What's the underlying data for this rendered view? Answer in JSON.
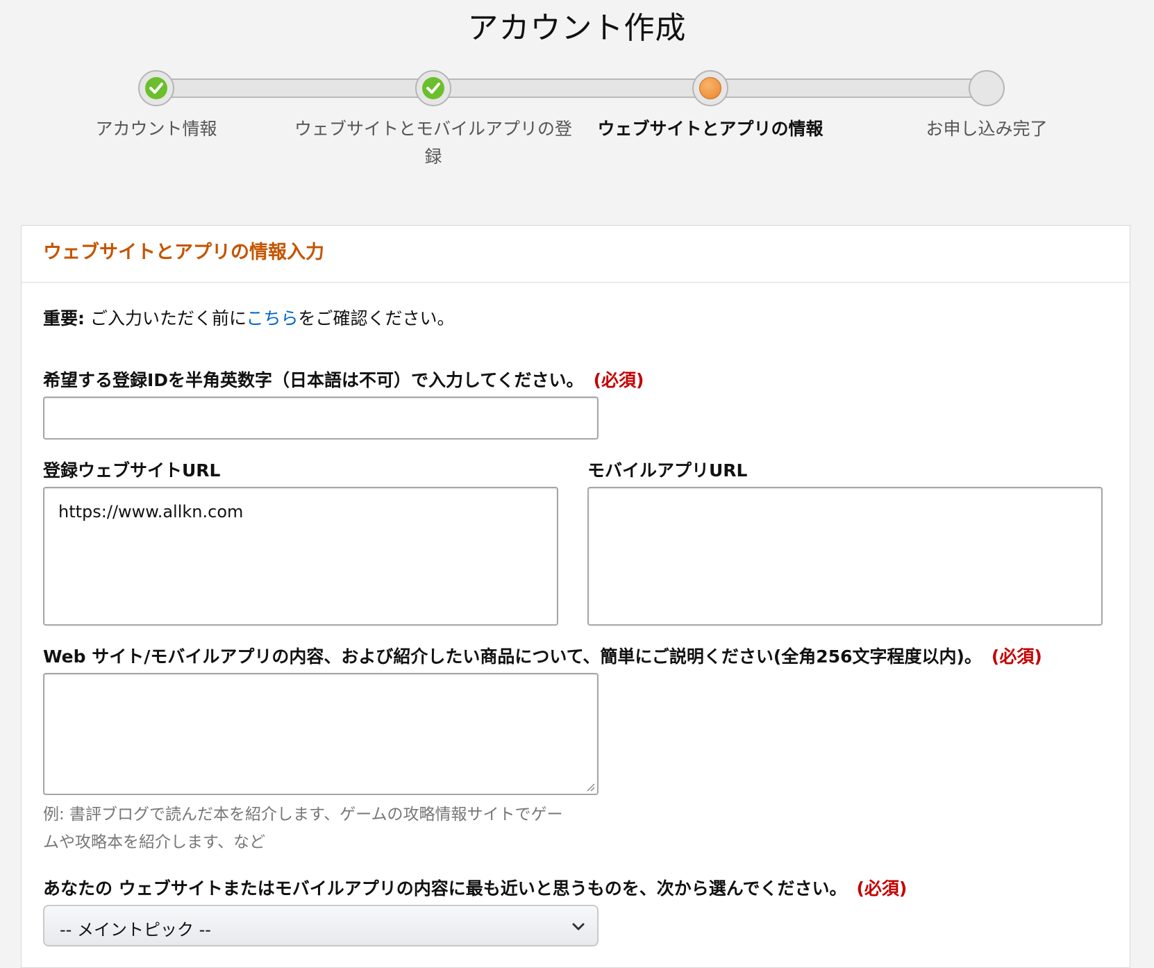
{
  "page": {
    "title": "アカウント作成"
  },
  "progress": {
    "steps": [
      {
        "label": "アカウント情報",
        "status": "done"
      },
      {
        "label": "ウェブサイトとモバイルアプリの登録",
        "status": "done"
      },
      {
        "label": "ウェブサイトとアプリの情報",
        "status": "current"
      },
      {
        "label": "お申し込み完了",
        "status": "pending"
      }
    ]
  },
  "panel": {
    "title": "ウェブサイトとアプリの情報入力",
    "notice": {
      "bold": "重要:",
      "before_link": " ご入力いただく前に",
      "link": "こちら",
      "after_link": "をご確認ください。"
    },
    "required_mark": "(必須)",
    "registration_id": {
      "label": "希望する登録IDを半角英数字（日本語は不可）で入力してください。",
      "value": ""
    },
    "website_url": {
      "label": "登録ウェブサイトURL",
      "value": "https://www.allkn.com"
    },
    "mobile_app_url": {
      "label": "モバイルアプリURL",
      "value": ""
    },
    "description": {
      "label": "Web サイト/モバイルアプリの内容、および紹介したい商品について、簡単にご説明ください(全角256文字程度以内)。",
      "value": "",
      "hint": "例: 書評ブログで読んだ本を紹介します、ゲームの攻略情報サイトでゲームや攻略本を紹介します、など"
    },
    "topic": {
      "label": "あなたの ウェブサイトまたはモバイルアプリの内容に最も近いと思うものを、次から選んでください。",
      "selected": "-- メイントピック --"
    }
  },
  "colors": {
    "accent_title": "#c45500",
    "required": "#c40000",
    "link": "#0066c0",
    "step_done": "#6cbf2c",
    "step_current": "#e9842c"
  },
  "icons": [
    "check-icon",
    "chevron-down-icon",
    "resize-grip-icon"
  ]
}
